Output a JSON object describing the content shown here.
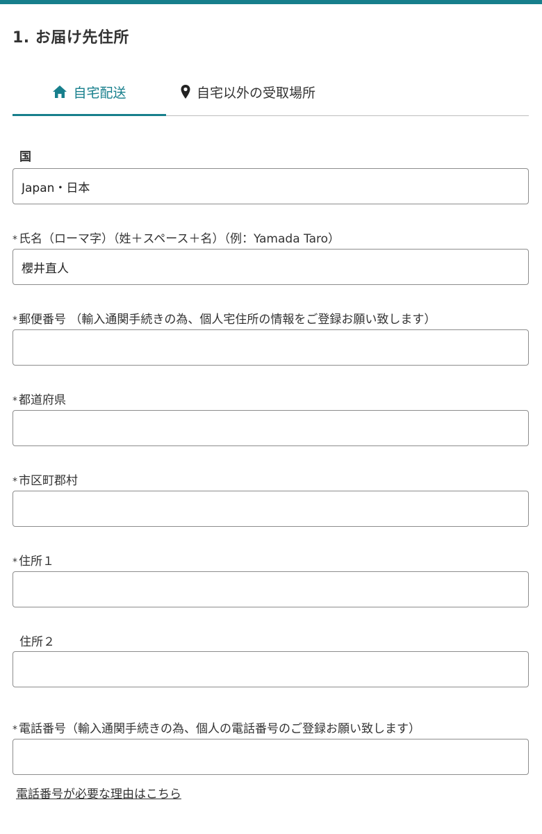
{
  "colors": {
    "accent": "#177f8c",
    "border": "#8c8c8c",
    "text": "#333333"
  },
  "section": {
    "title": "1. お届け先住所"
  },
  "tabs": [
    {
      "label": "自宅配送",
      "icon": "home-icon",
      "active": true
    },
    {
      "label": "自宅以外の受取場所",
      "icon": "location-pin-icon",
      "active": false
    }
  ],
  "form": {
    "required_mark": "*",
    "country": {
      "label": "国",
      "value": "Japan・日本"
    },
    "name": {
      "label": "氏名（ローマ字）（姓＋スペース＋名）（例：Yamada Taro）",
      "value": "櫻井直人"
    },
    "postal": {
      "label": "郵便番号 （輸入通関手続きの為、個人宅住所の情報をご登録お願い致します）",
      "value": ""
    },
    "prefecture": {
      "label": "都道府県",
      "value": ""
    },
    "city": {
      "label": "市区町郡村",
      "value": ""
    },
    "address1": {
      "label": "住所１",
      "value": ""
    },
    "address2": {
      "label": "住所２",
      "value": ""
    },
    "phone": {
      "label": "電話番号（輸入通関手続きの為、個人の電話番号のご登録お願い致します）",
      "value": ""
    }
  },
  "phone_reason_link": "電話番号が必要な理由はこちら"
}
